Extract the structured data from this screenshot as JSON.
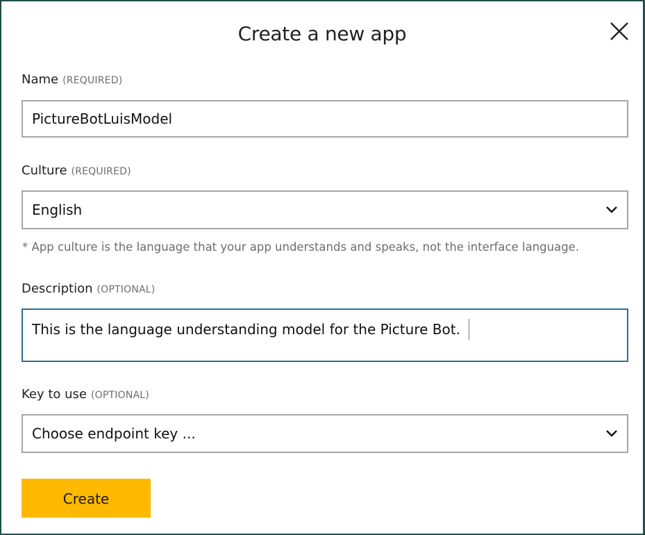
{
  "dialog": {
    "title": "Create a new app",
    "close_icon": "close-icon"
  },
  "name_field": {
    "label": "Name",
    "hint": "(REQUIRED)",
    "value": "PictureBotLuisModel"
  },
  "culture_field": {
    "label": "Culture",
    "hint": "(REQUIRED)",
    "value": "English",
    "icon": "chevron-down-icon",
    "note": "* App culture is the language that your app understands and speaks, not the interface language."
  },
  "description_field": {
    "label": "Description",
    "hint": "(OPTIONAL)",
    "value": "This is the language understanding model for the Picture Bot."
  },
  "key_field": {
    "label": "Key to use",
    "hint": "(OPTIONAL)",
    "value": "Choose endpoint key ...",
    "icon": "chevron-down-icon"
  },
  "actions": {
    "create_label": "Create"
  },
  "colors": {
    "accent": "#ffb900",
    "focus_border": "#2a6f97",
    "frame_border": "#1f4f4a"
  }
}
